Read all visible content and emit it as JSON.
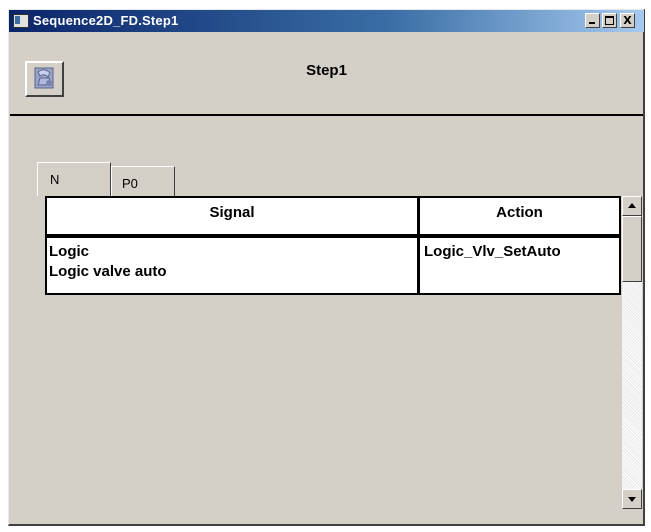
{
  "window": {
    "title": "Sequence2D_FD.Step1",
    "controls": {
      "minimize": "_",
      "maximize": "□",
      "close": "X"
    }
  },
  "header": {
    "step_title": "Step1",
    "step_icon": "step-settings-icon"
  },
  "tabs": [
    {
      "label": "N",
      "selected": true
    },
    {
      "label": "P0",
      "selected": false
    }
  ],
  "table": {
    "columns": [
      "Signal",
      "Action"
    ],
    "rows": [
      {
        "signal_line1": "Logic",
        "signal_line2": "Logic valve auto",
        "action": "Logic_Vlv_SetAuto"
      }
    ]
  },
  "colors": {
    "titlebar_start": "#0a246a",
    "titlebar_end": "#a6caf0",
    "window_bg": "#d4d0c8"
  }
}
